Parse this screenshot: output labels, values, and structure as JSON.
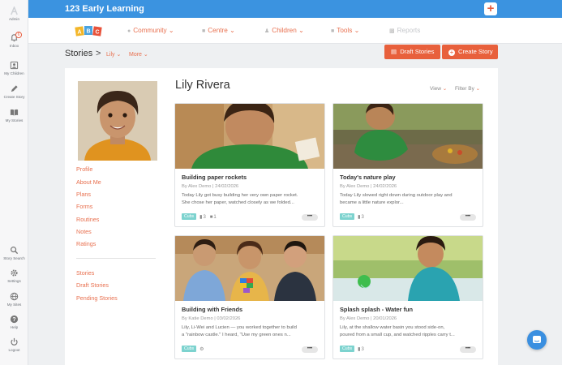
{
  "app": {
    "brand": "123 Early Learning",
    "plus_label": "+"
  },
  "rail": {
    "admin": "Admin",
    "inbox": "Inbox",
    "inbox_badge": "6",
    "my_children": "My Children",
    "create_story": "Create Story",
    "my_stories": "My Stories",
    "story_search": "Story Search",
    "settings": "Settings",
    "my_sites": "My Sites",
    "help": "Help",
    "logout": "Logout"
  },
  "logo": {
    "letters": [
      "A",
      "B",
      "C"
    ]
  },
  "nav": {
    "community": "Community",
    "centre": "Centre",
    "children": "Children",
    "tools": "Tools",
    "reports": "Reports"
  },
  "header": {
    "title": "Stories",
    "chevron": ">",
    "child_filter": "Lily",
    "more": "More",
    "draft_button": "Draft Stories",
    "create_button": "Create Story"
  },
  "profile": {
    "name": "Lily Rivera",
    "links": [
      "Profile",
      "About Me",
      "Plans",
      "Forms",
      "Routines",
      "Notes",
      "Ratings"
    ],
    "story_links": [
      "Stories",
      "Draft Stories",
      "Pending Stories"
    ],
    "view_label": "View",
    "filter_label": "Filter By"
  },
  "stories": [
    {
      "title": "Building paper rockets",
      "meta": "By Alex Demo | 24/02/2026",
      "body": "Today Lily got busy building her very own paper rocket.\nShe chose her paper, watched closely as we folded...",
      "tag": "Cubs",
      "photo_count": "3",
      "comment_count": "1",
      "more": "•••"
    },
    {
      "title": "Today's nature play",
      "meta": "By Alex Demo | 24/02/2026",
      "body": "Today Lily slowed right down during outdoor play and\nbecame a little nature explor...",
      "tag": "Cubs",
      "photo_count": "3",
      "more": "•••"
    },
    {
      "title": "Building with Friends",
      "meta": "By Katie Demo | 03/02/2026",
      "body": "Lily, Li-Wei and Lucien — you worked together to build\na \"rainbow castle.\" I heard, \"Use my green ones n...",
      "tag": "Cubs",
      "more": "•••"
    },
    {
      "title": "Splash splash - Water fun",
      "meta": "By Alex Demo | 20/01/2026",
      "body": "Lily, at the shallow water basin you stood side-on,\npoured from a small cup, and watched ripples carry t...",
      "tag": "Cubs",
      "photo_count": "3",
      "more": "•••"
    }
  ],
  "colors": {
    "topbar": "#3b93e0",
    "accent": "#e8603c",
    "link": "#e8704f",
    "tag": "#7dd3cf"
  }
}
